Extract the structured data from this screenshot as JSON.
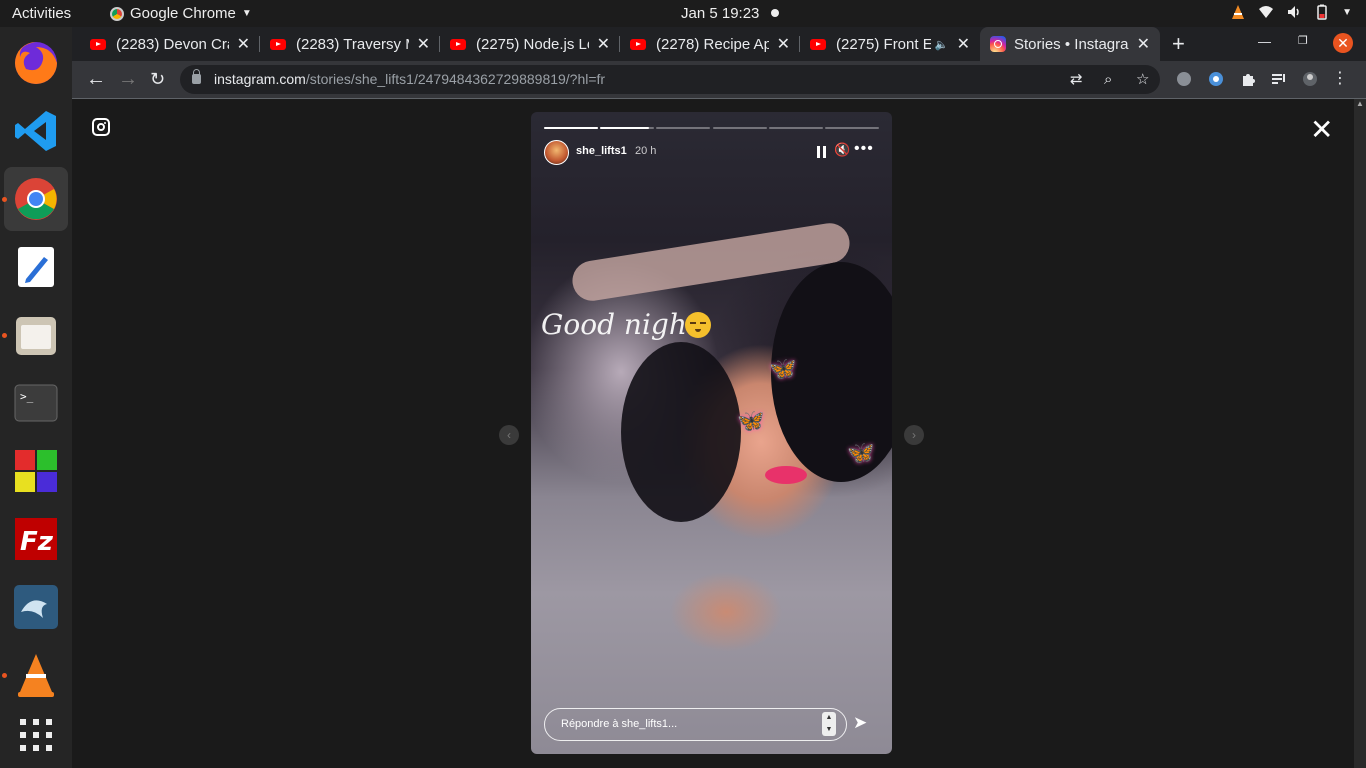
{
  "topbar": {
    "activities": "Activities",
    "app_name": "Google Chrome",
    "clock": "Jan 5  19:23"
  },
  "dock": {
    "items": [
      "firefox-icon",
      "vscode-icon",
      "chrome-icon",
      "text-editor-icon",
      "files-icon",
      "terminal-icon",
      "app-grid-color-icon",
      "filezilla-icon",
      "mysql-workbench-icon",
      "vlc-icon",
      "show-applications-icon"
    ]
  },
  "browser": {
    "tabs": [
      {
        "title": "(2283) Devon Cra",
        "icon": "youtube-icon"
      },
      {
        "title": "(2283) Traversy M",
        "icon": "youtube-icon"
      },
      {
        "title": "(2275) Node.js Lo",
        "icon": "youtube-icon"
      },
      {
        "title": "(2278) Recipe App",
        "icon": "youtube-icon"
      },
      {
        "title": "(2275) Front E",
        "icon": "youtube-icon",
        "audio": true
      },
      {
        "title": "Stories • Instagra",
        "icon": "instagram-icon",
        "active": true
      }
    ],
    "url_host": "instagram.com",
    "url_path": "/stories/she_lifts1/2479484362729889819/?hl=fr"
  },
  "story": {
    "username": "she_lifts1",
    "time": "20 h",
    "caption": "Good night",
    "reply_placeholder": "Répondre à she_lifts1...",
    "segments": 6,
    "current_segment": 2,
    "current_progress": 0.9
  },
  "colors": {
    "accent": "#e95420",
    "chrome_dark": "#202124",
    "toolbar": "#35363a",
    "page_bg": "#1a1a1a"
  }
}
